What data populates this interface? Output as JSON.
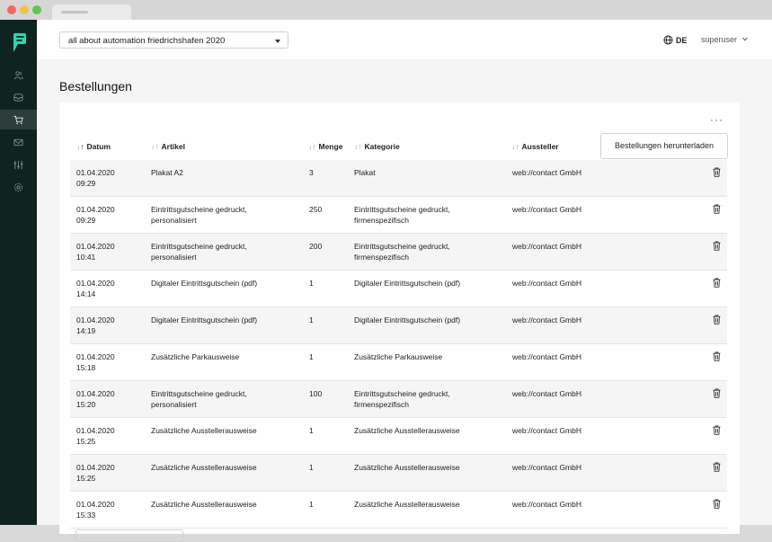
{
  "browser": {
    "tab_label": ""
  },
  "sidebar": {
    "colors": {
      "background": "#0f2421",
      "accent": "#2fd4b0"
    },
    "items": [
      {
        "icon": "users-icon",
        "active": false
      },
      {
        "icon": "inbox-icon",
        "active": false
      },
      {
        "icon": "cart-icon",
        "active": true
      },
      {
        "icon": "mail-icon",
        "active": false
      },
      {
        "icon": "sliders-icon",
        "active": false
      },
      {
        "icon": "gear-icon",
        "active": false
      }
    ]
  },
  "topbar": {
    "event_select": "all about automation friedrichshafen 2020",
    "language": "DE",
    "user": "superuser"
  },
  "page": {
    "title": "Bestellungen",
    "more_label": "···",
    "download_button": "Bestellungen herunterladen"
  },
  "table": {
    "columns": [
      {
        "label": "Datum",
        "sort": "asc"
      },
      {
        "label": "Artikel",
        "sort": "none"
      },
      {
        "label": "Menge",
        "sort": "none"
      },
      {
        "label": "Kategorie",
        "sort": "none"
      },
      {
        "label": "Aussteller",
        "sort": "none"
      }
    ],
    "rows": [
      {
        "date": "01.04.2020",
        "time": "09:29",
        "artikel1": "Plakat A2",
        "artikel2": "",
        "menge": "3",
        "kategorie1": "Plakat",
        "kategorie2": "",
        "aussteller": "web://contact GmbH"
      },
      {
        "date": "01.04.2020",
        "time": "09:29",
        "artikel1": "Eintrittsgutscheine gedruckt,",
        "artikel2": "personalisiert",
        "menge": "250",
        "kategorie1": "Eintrittsgutscheine gedruckt,",
        "kategorie2": "firmenspezifisch",
        "aussteller": "web://contact GmbH"
      },
      {
        "date": "01.04.2020",
        "time": "10:41",
        "artikel1": "Eintrittsgutscheine gedruckt,",
        "artikel2": "personalisiert",
        "menge": "200",
        "kategorie1": "Eintrittsgutscheine gedruckt,",
        "kategorie2": "firmenspezifisch",
        "aussteller": "web://contact GmbH"
      },
      {
        "date": "01.04.2020",
        "time": "14:14",
        "artikel1": "Digitaler Eintrittsgutschein (pdf)",
        "artikel2": "",
        "menge": "1",
        "kategorie1": "Digitaler Eintrittsgutschein (pdf)",
        "kategorie2": "",
        "aussteller": "web://contact GmbH"
      },
      {
        "date": "01.04.2020",
        "time": "14:19",
        "artikel1": "Digitaler Eintrittsgutschein (pdf)",
        "artikel2": "",
        "menge": "1",
        "kategorie1": "Digitaler Eintrittsgutschein (pdf)",
        "kategorie2": "",
        "aussteller": "web://contact GmbH"
      },
      {
        "date": "01.04.2020",
        "time": "15:18",
        "artikel1": "Zusätzliche Parkausweise",
        "artikel2": "",
        "menge": "1",
        "kategorie1": "Zusätzliche Parkausweise",
        "kategorie2": "",
        "aussteller": "web://contact GmbH"
      },
      {
        "date": "01.04.2020",
        "time": "15:20",
        "artikel1": "Eintrittsgutscheine gedruckt,",
        "artikel2": "personalisiert",
        "menge": "100",
        "kategorie1": "Eintrittsgutscheine gedruckt,",
        "kategorie2": "firmenspezifisch",
        "aussteller": "web://contact GmbH"
      },
      {
        "date": "01.04.2020",
        "time": "15:25",
        "artikel1": "Zusätzliche Ausstellerausweise",
        "artikel2": "",
        "menge": "1",
        "kategorie1": "Zusätzliche Ausstellerausweise",
        "kategorie2": "",
        "aussteller": "web://contact GmbH"
      },
      {
        "date": "01.04.2020",
        "time": "15:25",
        "artikel1": "Zusätzliche Ausstellerausweise",
        "artikel2": "",
        "menge": "1",
        "kategorie1": "Zusätzliche Ausstellerausweise",
        "kategorie2": "",
        "aussteller": "web://contact GmbH"
      },
      {
        "date": "01.04.2020",
        "time": "15:33",
        "artikel1": "Zusätzliche Ausstellerausweise",
        "artikel2": "",
        "menge": "1",
        "kategorie1": "Zusätzliche Ausstellerausweise",
        "kategorie2": "",
        "aussteller": "web://contact GmbH"
      }
    ]
  }
}
